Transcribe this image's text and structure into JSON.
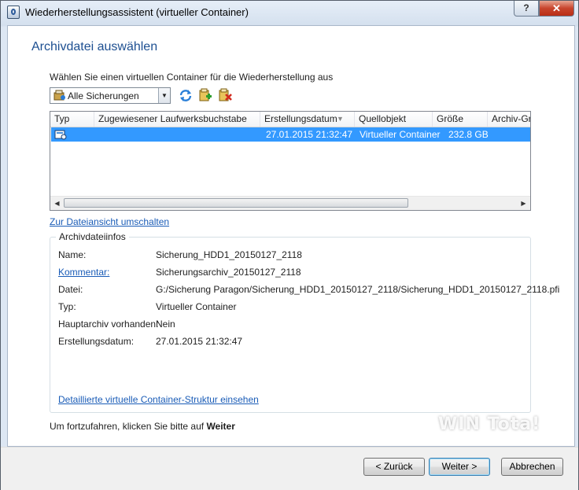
{
  "window": {
    "title": "Wiederherstellungsassistent (virtueller Container)",
    "help_label": "?",
    "close_label": "✕"
  },
  "page": {
    "heading": "Archivdatei auswählen",
    "instruction": "Wählen Sie einen virtuellen Container für die Wiederherstellung aus"
  },
  "filter": {
    "selected": "Alle Sicherungen",
    "arrow": "▼"
  },
  "list": {
    "columns": [
      "Typ",
      "Zugewiesener Laufwerksbuchstabe",
      "Erstellungsdatum",
      "Quellobjekt",
      "Größe",
      "Archiv-Grö"
    ],
    "sort_indicator": "▼",
    "rows": [
      {
        "typ": "",
        "laufwerk": "",
        "datum": "27.01.2015 21:32:47",
        "quelle": "Virtueller Container",
        "groesse": "232.8 GB",
        "archiv": ""
      }
    ],
    "scroll_left": "◀",
    "scroll_right": "▶"
  },
  "switch_view_link": "Zur Dateiansicht umschalten",
  "info": {
    "group_title": "Archivdateiinfos",
    "fields": [
      {
        "label": "Name:",
        "value": "Sicherung_HDD1_20150127_2118"
      },
      {
        "label": "Kommentar:",
        "value": "Sicherungsarchiv_20150127_2118"
      },
      {
        "label": "Datei:",
        "value": "G:/Sicherung Paragon/Sicherung_HDD1_20150127_2118/Sicherung_HDD1_20150127_2118.pfi"
      },
      {
        "label": "Typ:",
        "value": "Virtueller Container"
      },
      {
        "label": "Hauptarchiv vorhanden:",
        "value": "Nein"
      },
      {
        "label": "Erstellungsdatum:",
        "value": "27.01.2015 21:32:47"
      }
    ],
    "structure_link": "Detaillierte virtuelle Container-Struktur einsehen"
  },
  "hint": {
    "prefix": "Um fortzufahren, klicken Sie bitte auf",
    "bold": "Weiter"
  },
  "buttons": {
    "back": "< Zurück",
    "next": "Weiter >",
    "cancel": "Abbrechen"
  },
  "watermark": "WIN Tota!"
}
